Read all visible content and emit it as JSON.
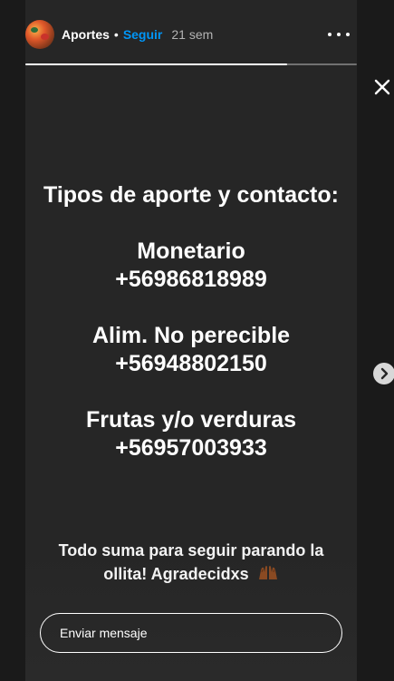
{
  "header": {
    "username": "Aportes",
    "separator": "•",
    "follow_label": "Seguir",
    "time": "21 sem"
  },
  "progress": {
    "fraction": 0.79
  },
  "story": {
    "heading": "Tipos de aporte y contacto:",
    "items": [
      {
        "label": "Monetario",
        "phone": "+56986818989"
      },
      {
        "label": "Alim. No perecible",
        "phone": "+56948802150"
      },
      {
        "label": "Frutas y/o verduras",
        "phone": "+56957003933"
      }
    ],
    "footer_line1": "Todo suma para seguir parando la",
    "footer_line2": "ollita! Agradecidxs"
  },
  "reply": {
    "placeholder": "Enviar mensaje"
  },
  "icons": {
    "more": "more-horizontal-icon",
    "close": "close-icon",
    "next": "chevron-right-icon",
    "hands": "raising-hands-emoji"
  },
  "colors": {
    "background": "#1a1a1a",
    "story_background": "#262626",
    "follow": "#0095f6",
    "time": "#b3b3b3"
  }
}
